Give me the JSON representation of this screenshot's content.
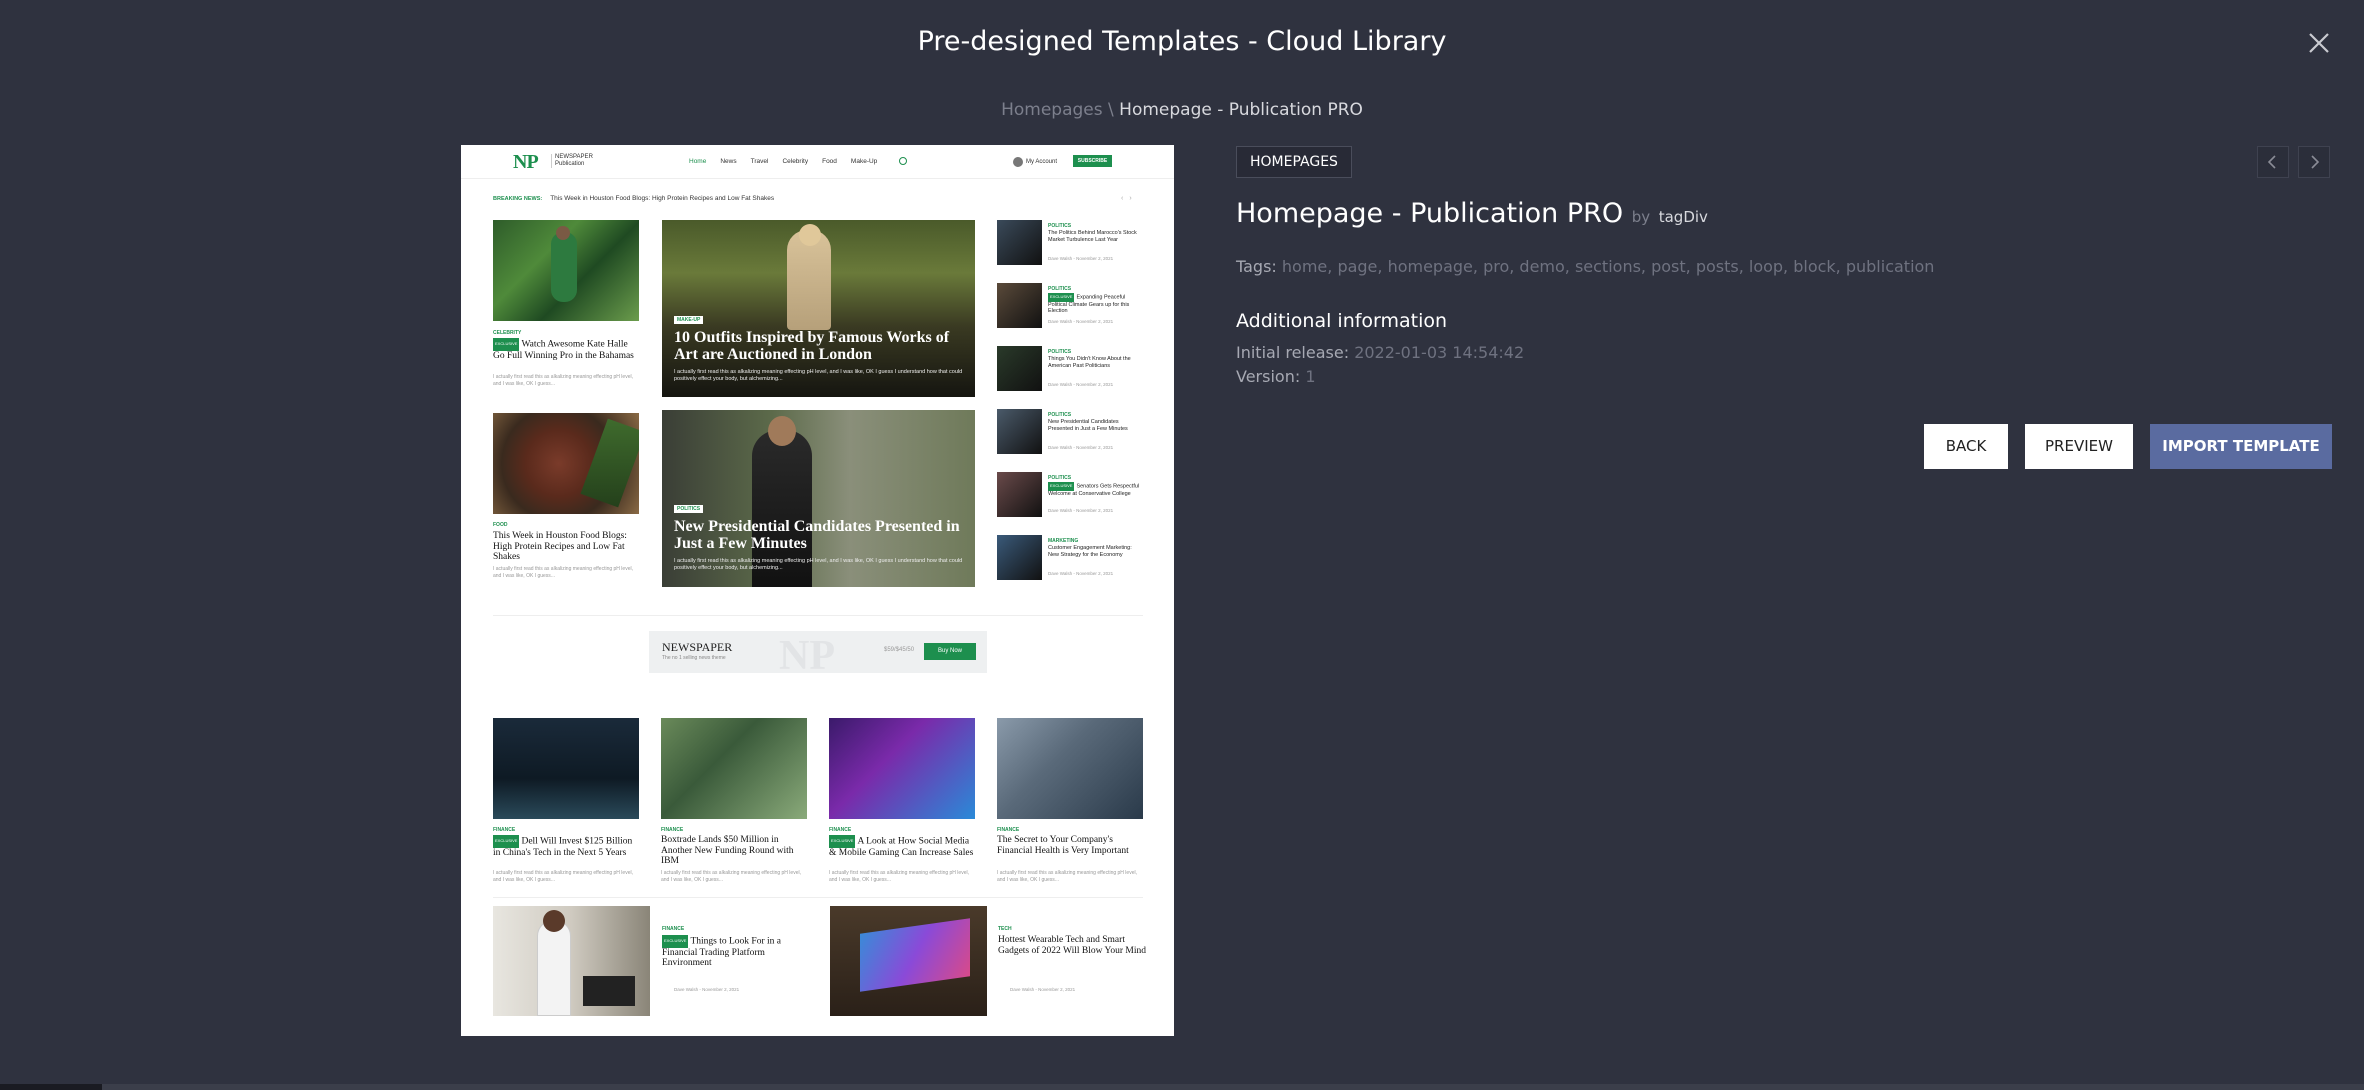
{
  "modal": {
    "title": "Pre-designed Templates - Cloud Library"
  },
  "breadcrumb": {
    "parent": "Homepages",
    "separator": "\\",
    "current": "Homepage - Publication PRO"
  },
  "template": {
    "category": "HOMEPAGES",
    "name": "Homepage - Publication PRO",
    "by": "by",
    "author": "tagDiv",
    "tags_label": "Tags:",
    "tags": "home, page, homepage, pro, demo, sections, post, posts, loop, block, publication",
    "additional_info_title": "Additional information",
    "initial_release_label": "Initial release:",
    "initial_release": "2022-01-03 14:54:42",
    "version_label": "Version:",
    "version": "1"
  },
  "buttons": {
    "back": "BACK",
    "preview": "PREVIEW",
    "import": "IMPORT TEMPLATE"
  },
  "preview": {
    "logo": "NP",
    "logo_sub_1": "NEWSPAPER",
    "logo_sub_2": "Publication",
    "nav": [
      "Home",
      "News",
      "Travel",
      "Celebrity",
      "Food",
      "Make-Up"
    ],
    "account": "My Account",
    "subscribe": "SUBSCRIBE",
    "breaking_label": "BREAKING NEWS:",
    "breaking_text": "This Week in Houston Food Blogs: High Protein Recipes and Low Fat Shakes",
    "left_top": {
      "cat": "CELEBRITY",
      "badge": "EXCLUSIVE",
      "title": "Watch Awesome Kate Halle Go Full Winning Pro in the Bahamas",
      "excerpt": "I actually first read this as alkalizing meaning effecting pH level, and I was like, OK I guess..."
    },
    "left_bottom": {
      "cat": "FOOD",
      "title": "This Week in Houston Food Blogs: High Protein Recipes and Low Fat Shakes",
      "excerpt": "I actually first read this as alkalizing meaning effecting pH level, and I was like, OK I guess..."
    },
    "big_1": {
      "tag": "MAKE-UP",
      "title": "10 Outfits Inspired by Famous Works of Art are Auctioned in London",
      "excerpt": "I actually first read this as alkalizing meaning effecting pH level, and I was like, OK I guess I understand how that could positively effect your body, but alchemizing..."
    },
    "big_2": {
      "tag": "POLITICS",
      "title": "New Presidential Candidates Presented in Just a Few Minutes",
      "excerpt": "I actually first read this as alkalizing meaning effecting pH level, and I was like, OK I guess I understand how that could positively effect your body, but alchemizing..."
    },
    "side": [
      {
        "cat": "POLITICS",
        "badge": "",
        "title": "The Politics Behind Marocco's Stock Market Turbulence Last Year",
        "meta": "Dave Walsh - November 2, 2021"
      },
      {
        "cat": "POLITICS",
        "badge": "EXCLUSIVE",
        "title": "Expanding Peaceful Political Climate Gears up for this Election",
        "meta": "Dave Walsh - November 2, 2021"
      },
      {
        "cat": "POLITICS",
        "badge": "",
        "title": "Things You Didn't Know About the American Past Politicians",
        "meta": "Dave Walsh - November 2, 2021"
      },
      {
        "cat": "POLITICS",
        "badge": "",
        "title": "New Presidential Candidates Presented in Just a Few Minutes",
        "meta": "Dave Walsh - November 2, 2021"
      },
      {
        "cat": "POLITICS",
        "badge": "EXCLUSIVE",
        "title": "Senators Gets Respectful Welcome at Conservative College",
        "meta": "Dave Walsh - November 2, 2021"
      },
      {
        "cat": "MARKETING",
        "badge": "",
        "title": "Customer Engagement Marketing: New Strategy for the Economy",
        "meta": "Dave Walsh - November 2, 2021"
      }
    ],
    "ad": {
      "title": "NEWSPAPER",
      "subtitle": "The no 1 selling news theme",
      "np": "NP",
      "price": "$59/$45/50",
      "buy": "Buy Now"
    },
    "grid": [
      {
        "cat": "FINANCE",
        "badge": "EXCLUSIVE",
        "title": "Dell Will Invest $125 Billion in China's Tech in the Next 5 Years",
        "excerpt": "I actually first read this as alkalizing meaning effecting pH level, and I was like, OK I guess..."
      },
      {
        "cat": "FINANCE",
        "badge": "",
        "title": "Boxtrade Lands $50 Million in Another New Funding Round with IBM",
        "excerpt": "I actually first read this as alkalizing meaning effecting pH level, and I was like, OK I guess..."
      },
      {
        "cat": "FINANCE",
        "badge": "EXCLUSIVE",
        "title": "A Look at How Social Media & Mobile Gaming Can Increase Sales",
        "excerpt": "I actually first read this as alkalizing meaning effecting pH level, and I was like, OK I guess..."
      },
      {
        "cat": "FINANCE",
        "badge": "",
        "title": "The Secret to Your Company's Financial Health is Very Important",
        "excerpt": "I actually first read this as alkalizing meaning effecting pH level, and I was like, OK I guess..."
      }
    ],
    "bottom": [
      {
        "cat": "FINANCE",
        "badge": "EXCLUSIVE",
        "title": "Things to Look For in a Financial Trading Platform Environment",
        "meta": "Dave Walsh - November 2, 2021"
      },
      {
        "cat": "TECH",
        "badge": "",
        "title": "Hottest Wearable Tech and Smart Gadgets of 2022 Will Blow Your Mind",
        "meta": "Dave Walsh - November 2, 2021"
      }
    ]
  },
  "colors": {
    "background": "#2f323f",
    "accent": "#5a6ba0",
    "preview_green": "#1d8f4e"
  },
  "icons": {
    "close": "close-icon",
    "prev": "chevron-left-icon",
    "next": "chevron-right-icon"
  }
}
